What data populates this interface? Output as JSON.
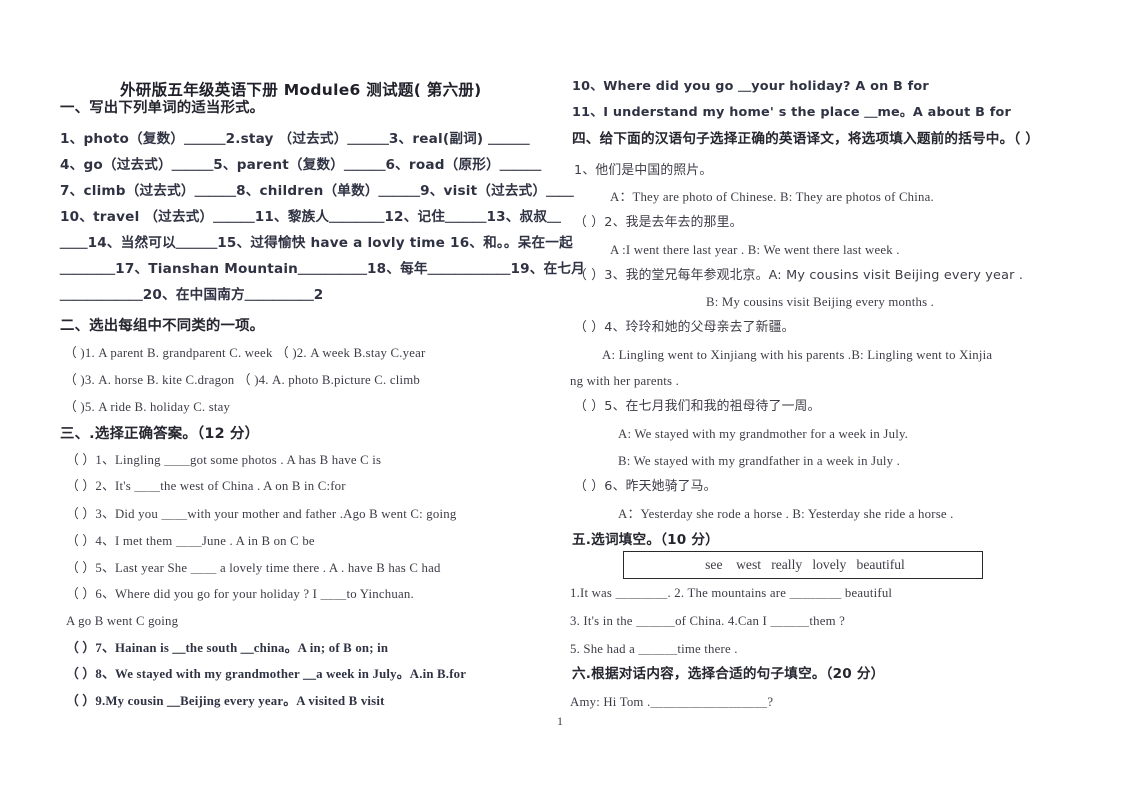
{
  "document": {
    "title": "外研版五年级英语下册 Module6 测试题( 第六册)",
    "page_number": "1"
  },
  "left_column": {
    "section1": {
      "heading": "一、写出下列单词的适当形式。",
      "lines": [
        "1、photo（复数）＿＿＿2.stay （过去式）＿＿＿3、real(副词) ＿＿＿",
        "4、go（过去式）＿＿＿5、parent（复数）＿＿＿6、road（原形）＿＿＿",
        "7、climb（过去式）＿＿＿8、children（单数）＿＿＿9、visit（过去式）＿＿",
        "10、travel （过去式）＿＿＿11、黎族人＿＿＿＿12、记住＿＿＿13、叔叔＿",
        "＿＿14、当然可以＿＿＿15、过得愉快 have a lovly time 16、和。。呆在一起",
        "＿＿＿＿17、Tianshan Mountain＿＿＿＿＿18、每年＿＿＿＿＿＿19、在七月",
        "＿＿＿＿＿＿20、在中国南方＿＿＿＿＿2"
      ]
    },
    "section2": {
      "heading": "二、选出每组中不同类的一项。",
      "lines": [
        "（    )1. A parent  B. grandparent C. week   （    )2. A week  B.stay   C.year",
        "（    )3. A. horse B. kite  C.dragon     （    )4. A. photo  B.picture  C. climb",
        "（    )5. A ride    B. holiday  C. stay"
      ]
    },
    "section3": {
      "heading": "三、.选择正确答案。（12 分）",
      "lines": [
        "（  ）1、Lingling ＿＿got some photos .        A has    B   have C is",
        "（  ）2、It's ＿＿the west of China .              A   on   B in  C:for",
        "（  ）3、Did you ＿＿with your mother and father .Ago B went C:  going",
        "（  ）4、I met them ＿＿June .       A in  B   on   C be",
        "（  ）5、Last year She ＿＿ a lovely time there . A .  have   B has   C had",
        "（  ）6、Where did you go for your holiday ? I ＿＿to Yinchuan.",
        "      A   go  B went   C going",
        "（  ）7、Hainan is ＿the south ＿china。A in; of  B   on; in",
        "（  ）8、We stayed with my grandmother ＿a week in July。A.in B.for",
        "（  ）9.My cousin ＿Beijing every year。A visited     B visit"
      ]
    }
  },
  "right_column": {
    "section3_cont": {
      "lines": [
        "10、Where did you go ＿your holiday?  A   on   B   for",
        "11、I understand my home' s the place  ＿me。A about B for"
      ]
    },
    "section4": {
      "heading": "四、给下面的汉语句子选择正确的英语译文，将选项填入题前的括号中。（  ）",
      "items": [
        {
          "prompt": "1、他们是中国的照片。",
          "options": "A：They are photo of Chinese.          B: They are photos of China."
        },
        {
          "prompt": "（  ）2、我是去年去的那里。",
          "options": "A :I went there last year .                B:  We went there last week ."
        },
        {
          "prompt": "（  ）3、我的堂兄每年参观北京。A: My cousins visit Beijing every year .",
          "options": "B: My cousins visit Beijing every months ."
        },
        {
          "prompt": "（  ）4、玲玲和她的父母亲去了新疆。",
          "options": "A: Lingling went to Xinjiang with his parents .B: Lingling went to Xinjia",
          "options2": "ng with her parents ."
        },
        {
          "prompt": "（  ）5、在七月我们和我的祖母待了一周。",
          "options": "A: We stayed with my grandmother for a week in July.",
          "options2": "B: We stayed with my grandfather in a week in July ."
        },
        {
          "prompt": "（  ）6、昨天她骑了马。",
          "options": "A：Yesterday she rode a horse .   B: Yesterday she ride a horse ."
        }
      ]
    },
    "section5": {
      "heading": "五.选词填空。（10 分）",
      "word_bank": "see    west   really   lovely   beautiful",
      "lines": [
        "1.It was ＿＿＿＿.                            2. The mountains are ＿＿＿＿ beautiful",
        "3. It's in the ＿＿＿of China.            4.Can I ＿＿＿them ?",
        "5. She had a ＿＿＿time there ."
      ]
    },
    "section6": {
      "heading": "六.根据对话内容，选择合适的句子填空。（20 分）",
      "lines": [
        "Amy: Hi Tom .＿＿＿＿＿＿＿＿＿?"
      ]
    }
  }
}
